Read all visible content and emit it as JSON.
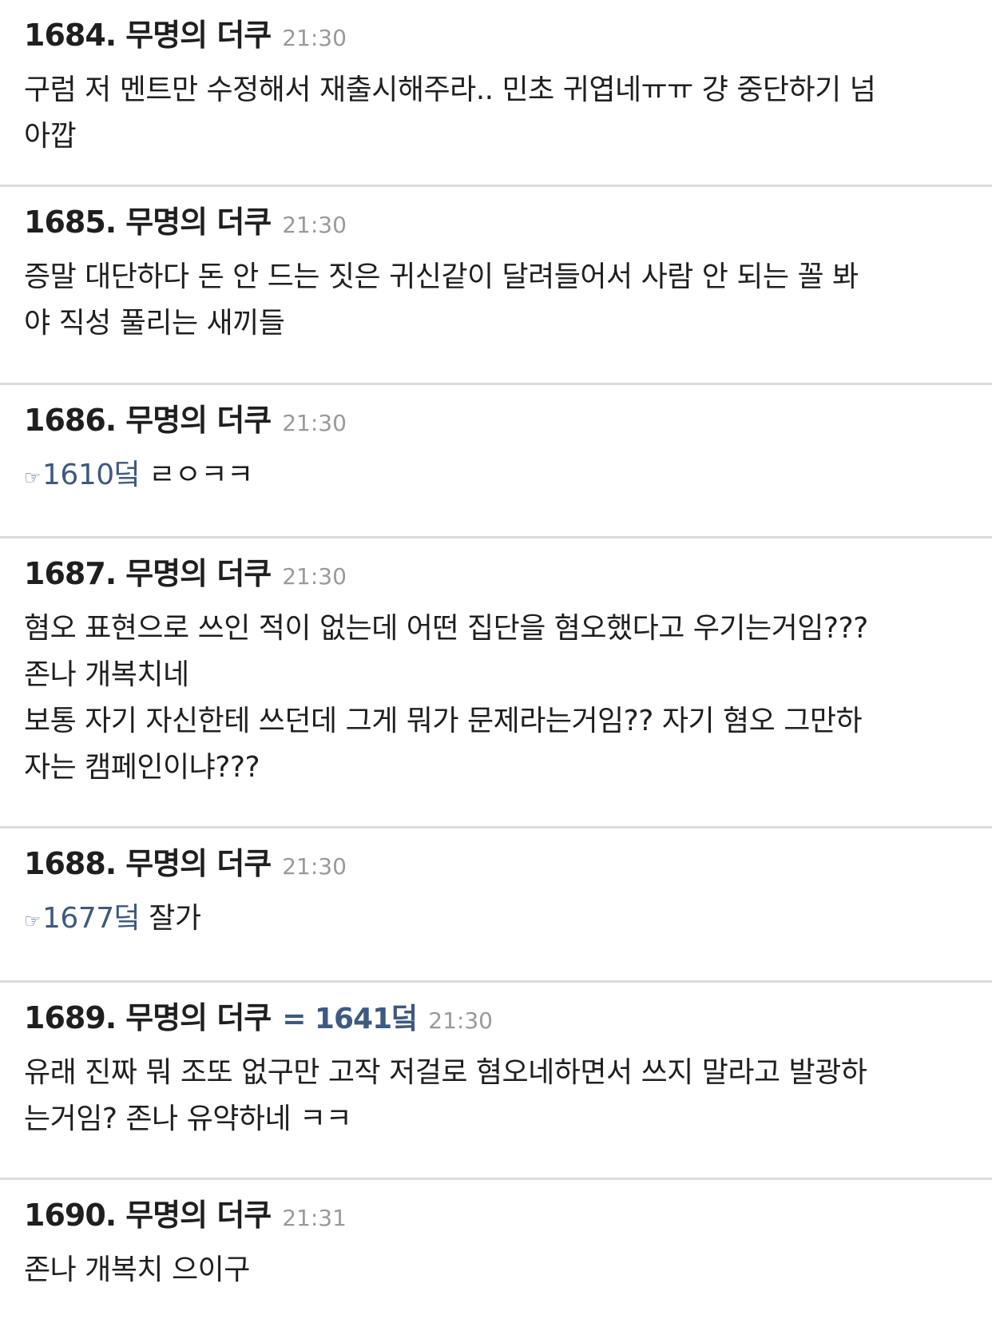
{
  "posts": [
    {
      "num": "1684.",
      "author": "무명의 더쿠",
      "time": "21:30",
      "lines": [
        "구럼 저 멘트만 수정해서 재출시해주라.. 민초 귀엽네ㅠㅠ 걍 중단하기 넘",
        "아깝"
      ]
    },
    {
      "num": "1685.",
      "author": "무명의 더쿠",
      "time": "21:30",
      "lines": [
        "증말 대단하다 돈 안 드는 짓은 귀신같이 달려들어서 사람 안 되는 꼴 봐",
        "야 직성 풀리는 새끼들"
      ]
    },
    {
      "num": "1686.",
      "author": "무명의 더쿠",
      "time": "21:30",
      "anchor_hand": "☞",
      "anchor": "1610덬",
      "text": " ㄹㅇㅋㅋ"
    },
    {
      "num": "1687.",
      "author": "무명의 더쿠",
      "time": "21:30",
      "lines": [
        "혐오 표현으로 쓰인 적이 없는데 어떤 집단을 혐오했다고 우기는거임???",
        "존나 개복치네",
        "보통 자기 자신한테 쓰던데 그게 뭐가 문제라는거임?? 자기 혐오 그만하",
        "자는 캠페인이냐???"
      ]
    },
    {
      "num": "1688.",
      "author": "무명의 더쿠",
      "time": "21:30",
      "anchor_hand": "☞",
      "anchor": "1677덬",
      "text": " 잘가"
    },
    {
      "num": "1689.",
      "author": "무명의 더쿠",
      "ref": "= 1641덬",
      "time": "21:30",
      "lines": [
        "유래 진짜 뭐 조또 없구만 고작 저걸로 혐오네하면서 쓰지 말라고 발광하",
        "는거임? 존나 유약하네 ㅋㅋ"
      ]
    },
    {
      "num": "1690.",
      "author": "무명의 더쿠",
      "time": "21:31",
      "lines": [
        "존나 개복치 으이구"
      ]
    }
  ]
}
